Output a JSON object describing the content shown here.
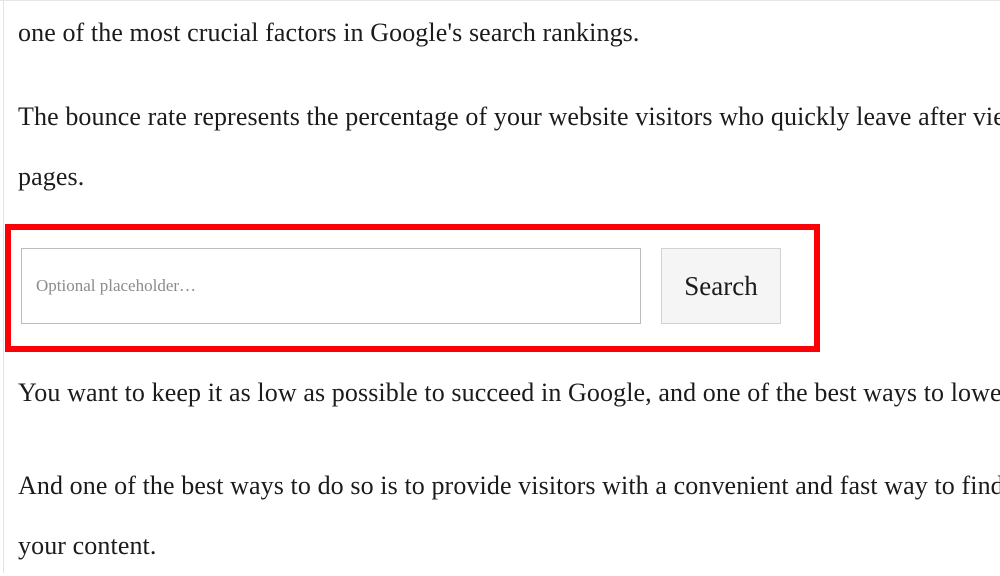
{
  "article": {
    "paragraph_1": "one of the most crucial factors in Google's search rankings.",
    "paragraph_2_line_1": "The bounce rate represents the percentage of your website visitors who quickly leave after viewing only one of your",
    "paragraph_2_line_2": "pages.",
    "paragraph_3": "You want to keep it as low as possible to succeed in Google, and one of the best ways to lower it is to keep visitors engaged.",
    "paragraph_4_line_1": "And one of the best ways to do so is to provide visitors with a convenient and fast way to find exactly what they need in",
    "paragraph_4_line_2": "your content."
  },
  "search_widget": {
    "input_placeholder": "Optional placeholder…",
    "input_value": "",
    "button_label": "Search"
  },
  "annotation": {
    "highlight_color": "#fb0007",
    "highlight_border_width_px": 6
  },
  "colors": {
    "page_background": "#ffffff",
    "body_text": "#1b1b1b",
    "placeholder_text": "#8b8b8b",
    "input_border": "#bcbcbc",
    "button_background": "#f5f5f5",
    "button_border": "#d2d2d2",
    "page_rule": "#e3e3e3"
  }
}
